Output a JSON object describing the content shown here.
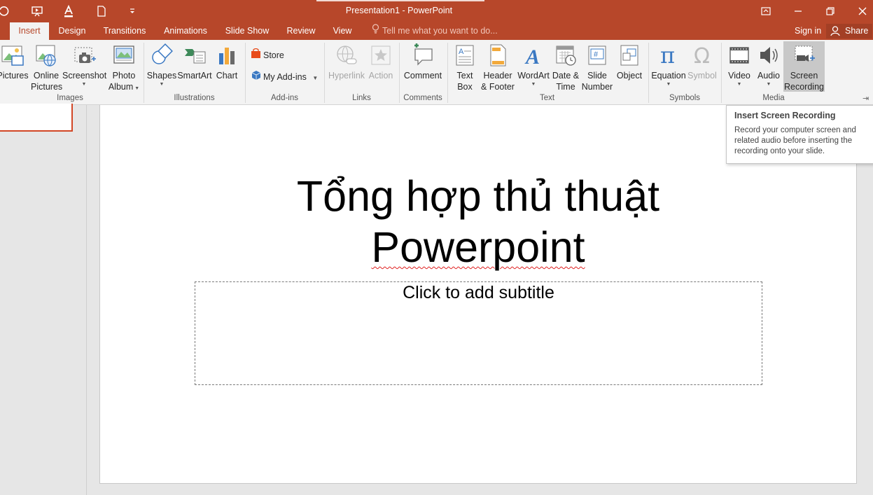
{
  "window": {
    "title": "Presentation1 - PowerPoint",
    "quick_access": [
      "undo-icon",
      "present-from-start-icon",
      "font-color-icon",
      "new-file-icon",
      "customize-qat-icon"
    ],
    "controls": [
      "ribbon-display-options-icon",
      "minimize-icon",
      "restore-icon",
      "close-icon"
    ]
  },
  "tabs": [
    {
      "label": "Insert",
      "active": true
    },
    {
      "label": "Design"
    },
    {
      "label": "Transitions"
    },
    {
      "label": "Animations"
    },
    {
      "label": "Slide Show"
    },
    {
      "label": "Review"
    },
    {
      "label": "View"
    }
  ],
  "tell_me": "Tell me what you want to do...",
  "sign_in": "Sign in",
  "share": "Share",
  "ribbon": {
    "groups": {
      "images": "Images",
      "illustrations": "Illustrations",
      "addins": "Add-ins",
      "links": "Links",
      "comments": "Comments",
      "text": "Text",
      "symbols": "Symbols",
      "media": "Media"
    },
    "pictures": "Pictures",
    "online_pictures": {
      "line1": "Online",
      "line2": "Pictures"
    },
    "screenshot": "Screenshot",
    "photo_album": {
      "line1": "Photo",
      "line2": "Album"
    },
    "shapes": "Shapes",
    "smartart": "SmartArt",
    "chart": "Chart",
    "store": "Store",
    "my_addins": "My Add-ins",
    "hyperlink": "Hyperlink",
    "action": "Action",
    "comment": "Comment",
    "text_box": {
      "line1": "Text",
      "line2": "Box"
    },
    "header_footer": {
      "line1": "Header",
      "line2": "& Footer"
    },
    "wordart": "WordArt",
    "date_time": {
      "line1": "Date &",
      "line2": "Time"
    },
    "slide_number": {
      "line1": "Slide",
      "line2": "Number"
    },
    "object": "Object",
    "equation": "Equation",
    "symbol": "Symbol",
    "video": "Video",
    "audio": "Audio",
    "screen_recording": {
      "line1": "Screen",
      "line2": "Recording"
    }
  },
  "slide": {
    "title_line1": "Tổng hợp thủ thuật",
    "title_line2": "Powerpoint",
    "subtitle_placeholder": "Click to add subtitle"
  },
  "tooltip": {
    "title": "Insert Screen Recording",
    "body": "Record your computer screen and related audio before inserting the recording onto your slide."
  },
  "colors": {
    "accent": "#b7472a",
    "ribbon": "#f3f3f3",
    "selection": "#d24726"
  }
}
